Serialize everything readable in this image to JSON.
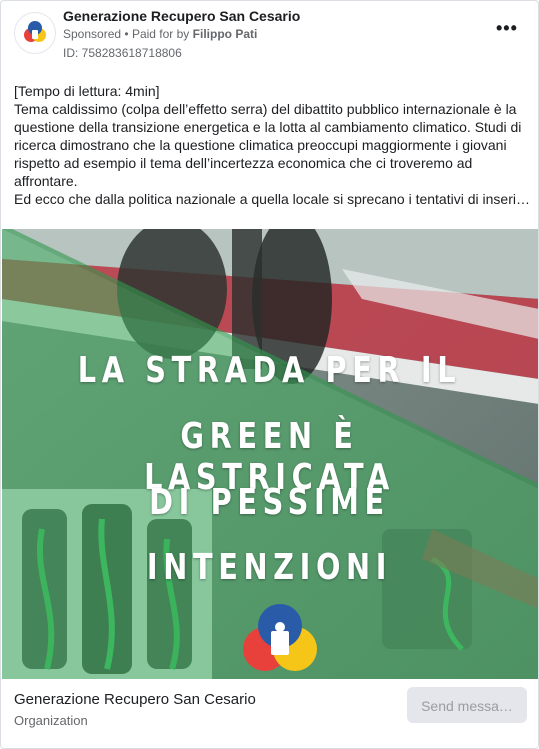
{
  "advertiser": {
    "name": "Generazione Recupero San Cesario",
    "sponsored_label": "Sponsored",
    "separator": "•",
    "paid_for_label": "Paid for by",
    "payer": "Filippo Pati",
    "ad_id": "ID: 758283618718806",
    "logo_icon": "recycling-logo-icon"
  },
  "more_icon": "more-options-icon",
  "body_text": {
    "line1": "[Tempo di lettura: 4min]",
    "line2": "Tema caldissimo (colpa dell’effetto serra) del dibattito pubblico internazionale è la",
    "line3": "questione della transizione energetica e la lotta al cambiamento climatico. Studi di",
    "line4": "ricerca dimostrano che la questione climatica preoccupi maggiormente i giovani",
    "line5": "rispetto ad esempio il tema dell’incertezza economica che ci troveremo ad",
    "line6": "affrontare.",
    "line7": "Ed ecco che dalla politica nazionale a quella locale si sprecano i tentativi di inseri…"
  },
  "creative": {
    "headline_1": "LA STRADA PER IL",
    "headline_2": "GREEN È LASTRICATA",
    "headline_3": "DI PESSIME",
    "headline_4": "INTENZIONI",
    "colors": {
      "overlay_green": "#3fae5e",
      "track_red": "#c43d4b",
      "logo_red": "#e8413c",
      "logo_yellow": "#f5c518",
      "logo_blue": "#2a5ba8"
    }
  },
  "footer": {
    "page_name": "Generazione Recupero San Cesario",
    "page_type": "Organization",
    "cta_label": "Send messa…"
  }
}
